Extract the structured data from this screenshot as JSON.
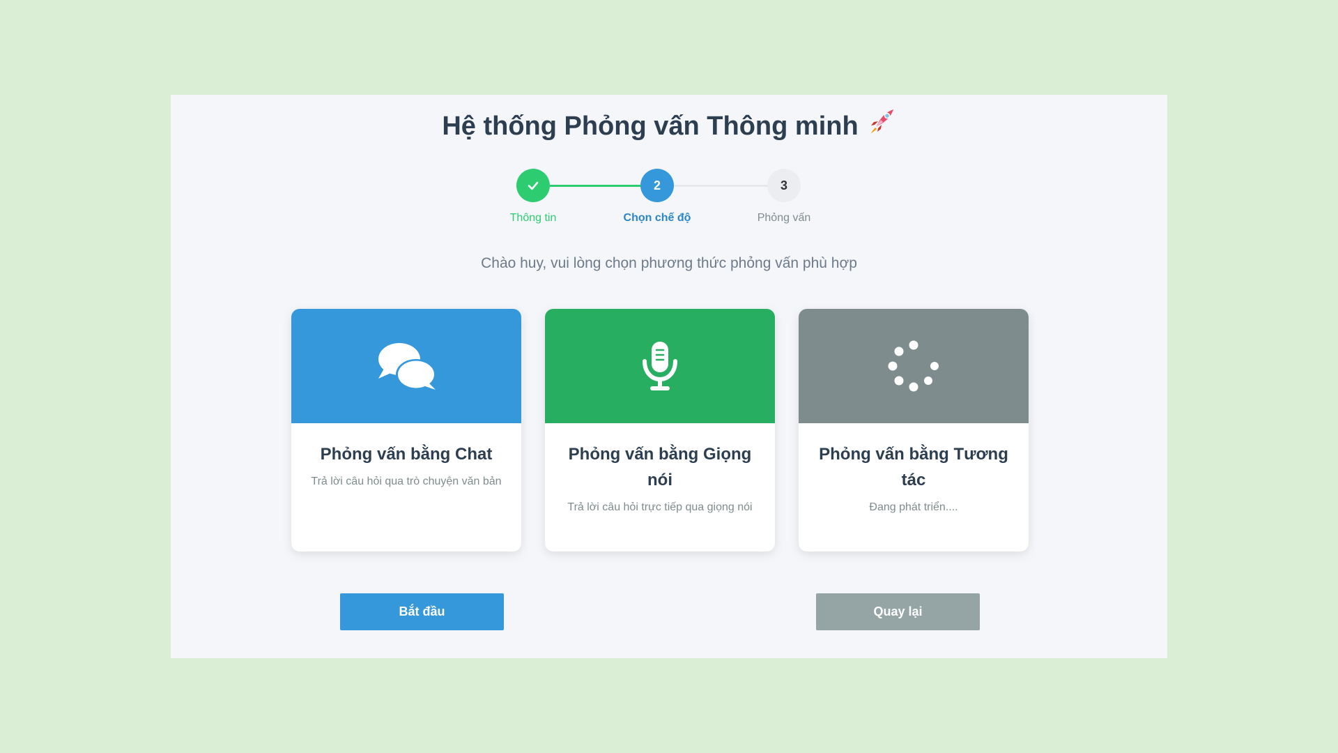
{
  "header": {
    "title": "Hệ thống Phỏng vấn Thông minh",
    "title_icon": "rocket-icon"
  },
  "stepper": {
    "steps": [
      {
        "number": "1",
        "label": "Thông tin",
        "status": "completed",
        "icon": "check-icon",
        "color": "#2ecc71"
      },
      {
        "number": "2",
        "label": "Chọn chế độ",
        "status": "active",
        "color": "#3498db"
      },
      {
        "number": "3",
        "label": "Phỏng vấn",
        "status": "pending",
        "color": "#ebedf0"
      }
    ]
  },
  "greeting": "Chào huy, vui lòng chọn phương thức phỏng vấn phù hợp",
  "modes": [
    {
      "title": "Phỏng vấn bằng Chat",
      "description": "Trả lời câu hỏi qua trò chuyện văn bản",
      "icon": "chat-bubbles-icon",
      "color": "#3498db"
    },
    {
      "title": "Phỏng vấn bằng Giọng nói",
      "description": "Trả lời câu hỏi trực tiếp qua giọng nói",
      "icon": "microphone-icon",
      "color": "#27ae60"
    },
    {
      "title": "Phỏng vấn bằng Tương tác",
      "description": "Đang phát triển....",
      "icon": "spinner-icon",
      "color": "#7f8c8d"
    }
  ],
  "actions": {
    "start_label": "Bắt đầu",
    "back_label": "Quay lại"
  }
}
